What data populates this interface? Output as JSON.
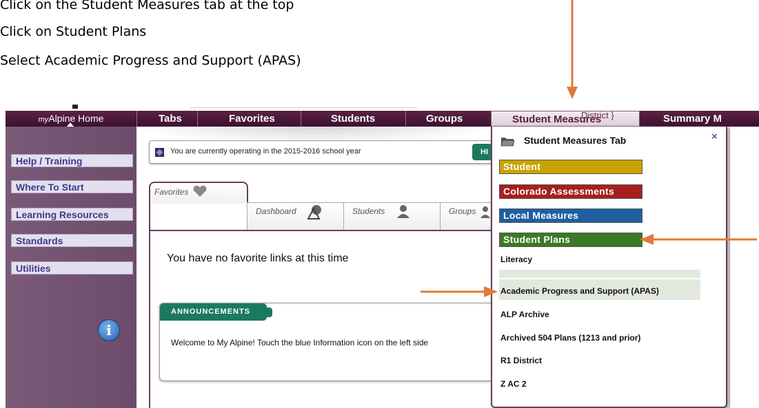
{
  "instructions": [
    "Click on the Student Measures tab at the top",
    "Click on Student Plans",
    "Select Academic Progress and Support (APAS)"
  ],
  "colors": {
    "arrow": "#e07b39",
    "nav_bg": "#4a1838",
    "sidebar_bg": "#72536f",
    "cat_student": "#c9a300",
    "cat_colorado": "#a61f1f",
    "cat_local": "#1f5fa0",
    "cat_plans": "#3b7a25",
    "announce_header": "#1b7a5e"
  },
  "nav": {
    "home_prefix": "my",
    "home_label": "Alpine Home",
    "tabs": [
      "Tabs",
      "Favorites",
      "Students",
      "Groups",
      "Student Measures",
      "Summary M"
    ],
    "overlay_text": "District }"
  },
  "sidebar": {
    "items": [
      "Help / Training",
      "Where To Start",
      "Learning Resources",
      "Standards",
      "Utilities"
    ],
    "info_icon_glyph": "i"
  },
  "notice": {
    "text": "You are currently operating in the 2015-2016 school year",
    "button": "HI"
  },
  "tabs": {
    "favorites": "Favorites",
    "dashboard": "Dashboard",
    "students": "Students",
    "groups": "Groups"
  },
  "favorites_empty": "You have no favorite links at this time",
  "announcements": {
    "header": "ANNOUNCEMENTS",
    "message": "Welcome to My Alpine! Touch the blue Information icon on the left side"
  },
  "dropdown": {
    "title": "Student Measures Tab",
    "close": "×",
    "categories": [
      "Student",
      "Colorado Assessments",
      "Local Measures",
      "Student Plans"
    ],
    "items": [
      "Literacy",
      "Academic Progress and Support (APAS)",
      "ALP Archive",
      "Archived 504 Plans (1213 and prior)",
      "R1 District",
      "Z AC 2"
    ]
  }
}
